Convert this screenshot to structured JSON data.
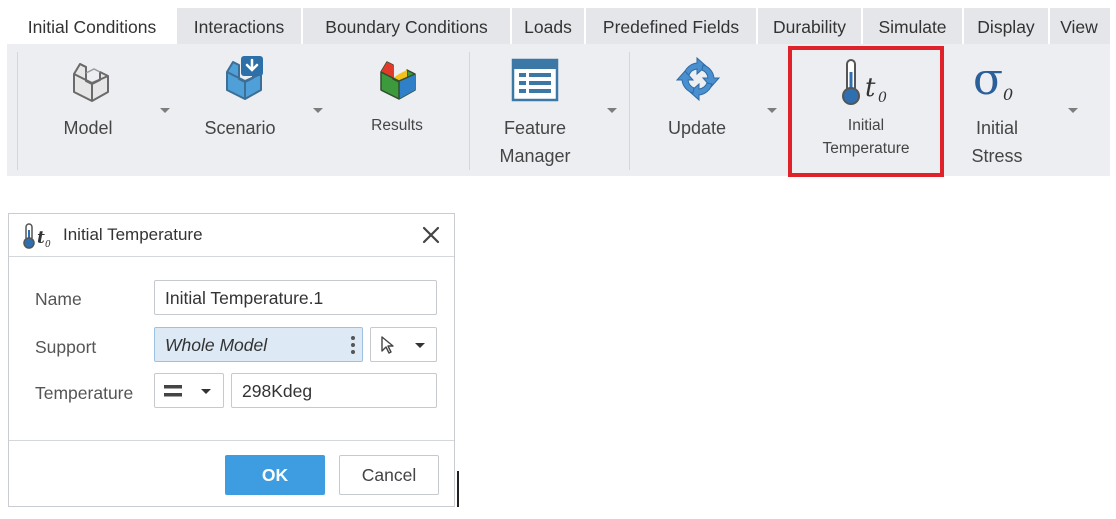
{
  "tabs": [
    {
      "label": "Initial Conditions",
      "active": true
    },
    {
      "label": "Interactions"
    },
    {
      "label": "Boundary Conditions"
    },
    {
      "label": "Loads"
    },
    {
      "label": "Predefined Fields"
    },
    {
      "label": "Durability"
    },
    {
      "label": "Simulate"
    },
    {
      "label": "Display"
    },
    {
      "label": "View"
    }
  ],
  "ribbon": {
    "model": {
      "label": "Model",
      "icon": "model-part-icon"
    },
    "scenario": {
      "label": "Scenario",
      "icon": "scenario-icon"
    },
    "results": {
      "label": "Results",
      "icon": "results-icon"
    },
    "feature_manager": {
      "label_line1": "Feature",
      "label_line2": "Manager",
      "icon": "feature-manager-icon"
    },
    "update": {
      "label": "Update",
      "icon": "update-icon"
    },
    "initial_temperature": {
      "label_line1": "Initial",
      "label_line2": "Temperature",
      "icon": "thermometer-icon",
      "icon_text": "t",
      "icon_sub": "0"
    },
    "initial_stress": {
      "label_line1": "Initial",
      "label_line2": "Stress",
      "icon": "sigma-icon",
      "icon_text": "σ",
      "icon_sub": "0"
    }
  },
  "dialog": {
    "title": "Initial Temperature",
    "icon_text": "t",
    "icon_sub": "0",
    "name_label": "Name",
    "name_value": "Initial Temperature.1",
    "support_label": "Support",
    "support_value": "Whole Model",
    "temperature_label": "Temperature",
    "temperature_value": "298Kdeg",
    "ok_label": "OK",
    "cancel_label": "Cancel"
  },
  "colors": {
    "highlight": "#e0212a",
    "ok_button": "#3d9de0",
    "support_bg": "#dde9f5",
    "ribbon_bg": "#eceef1",
    "tab_bg": "#e4e6ea"
  }
}
